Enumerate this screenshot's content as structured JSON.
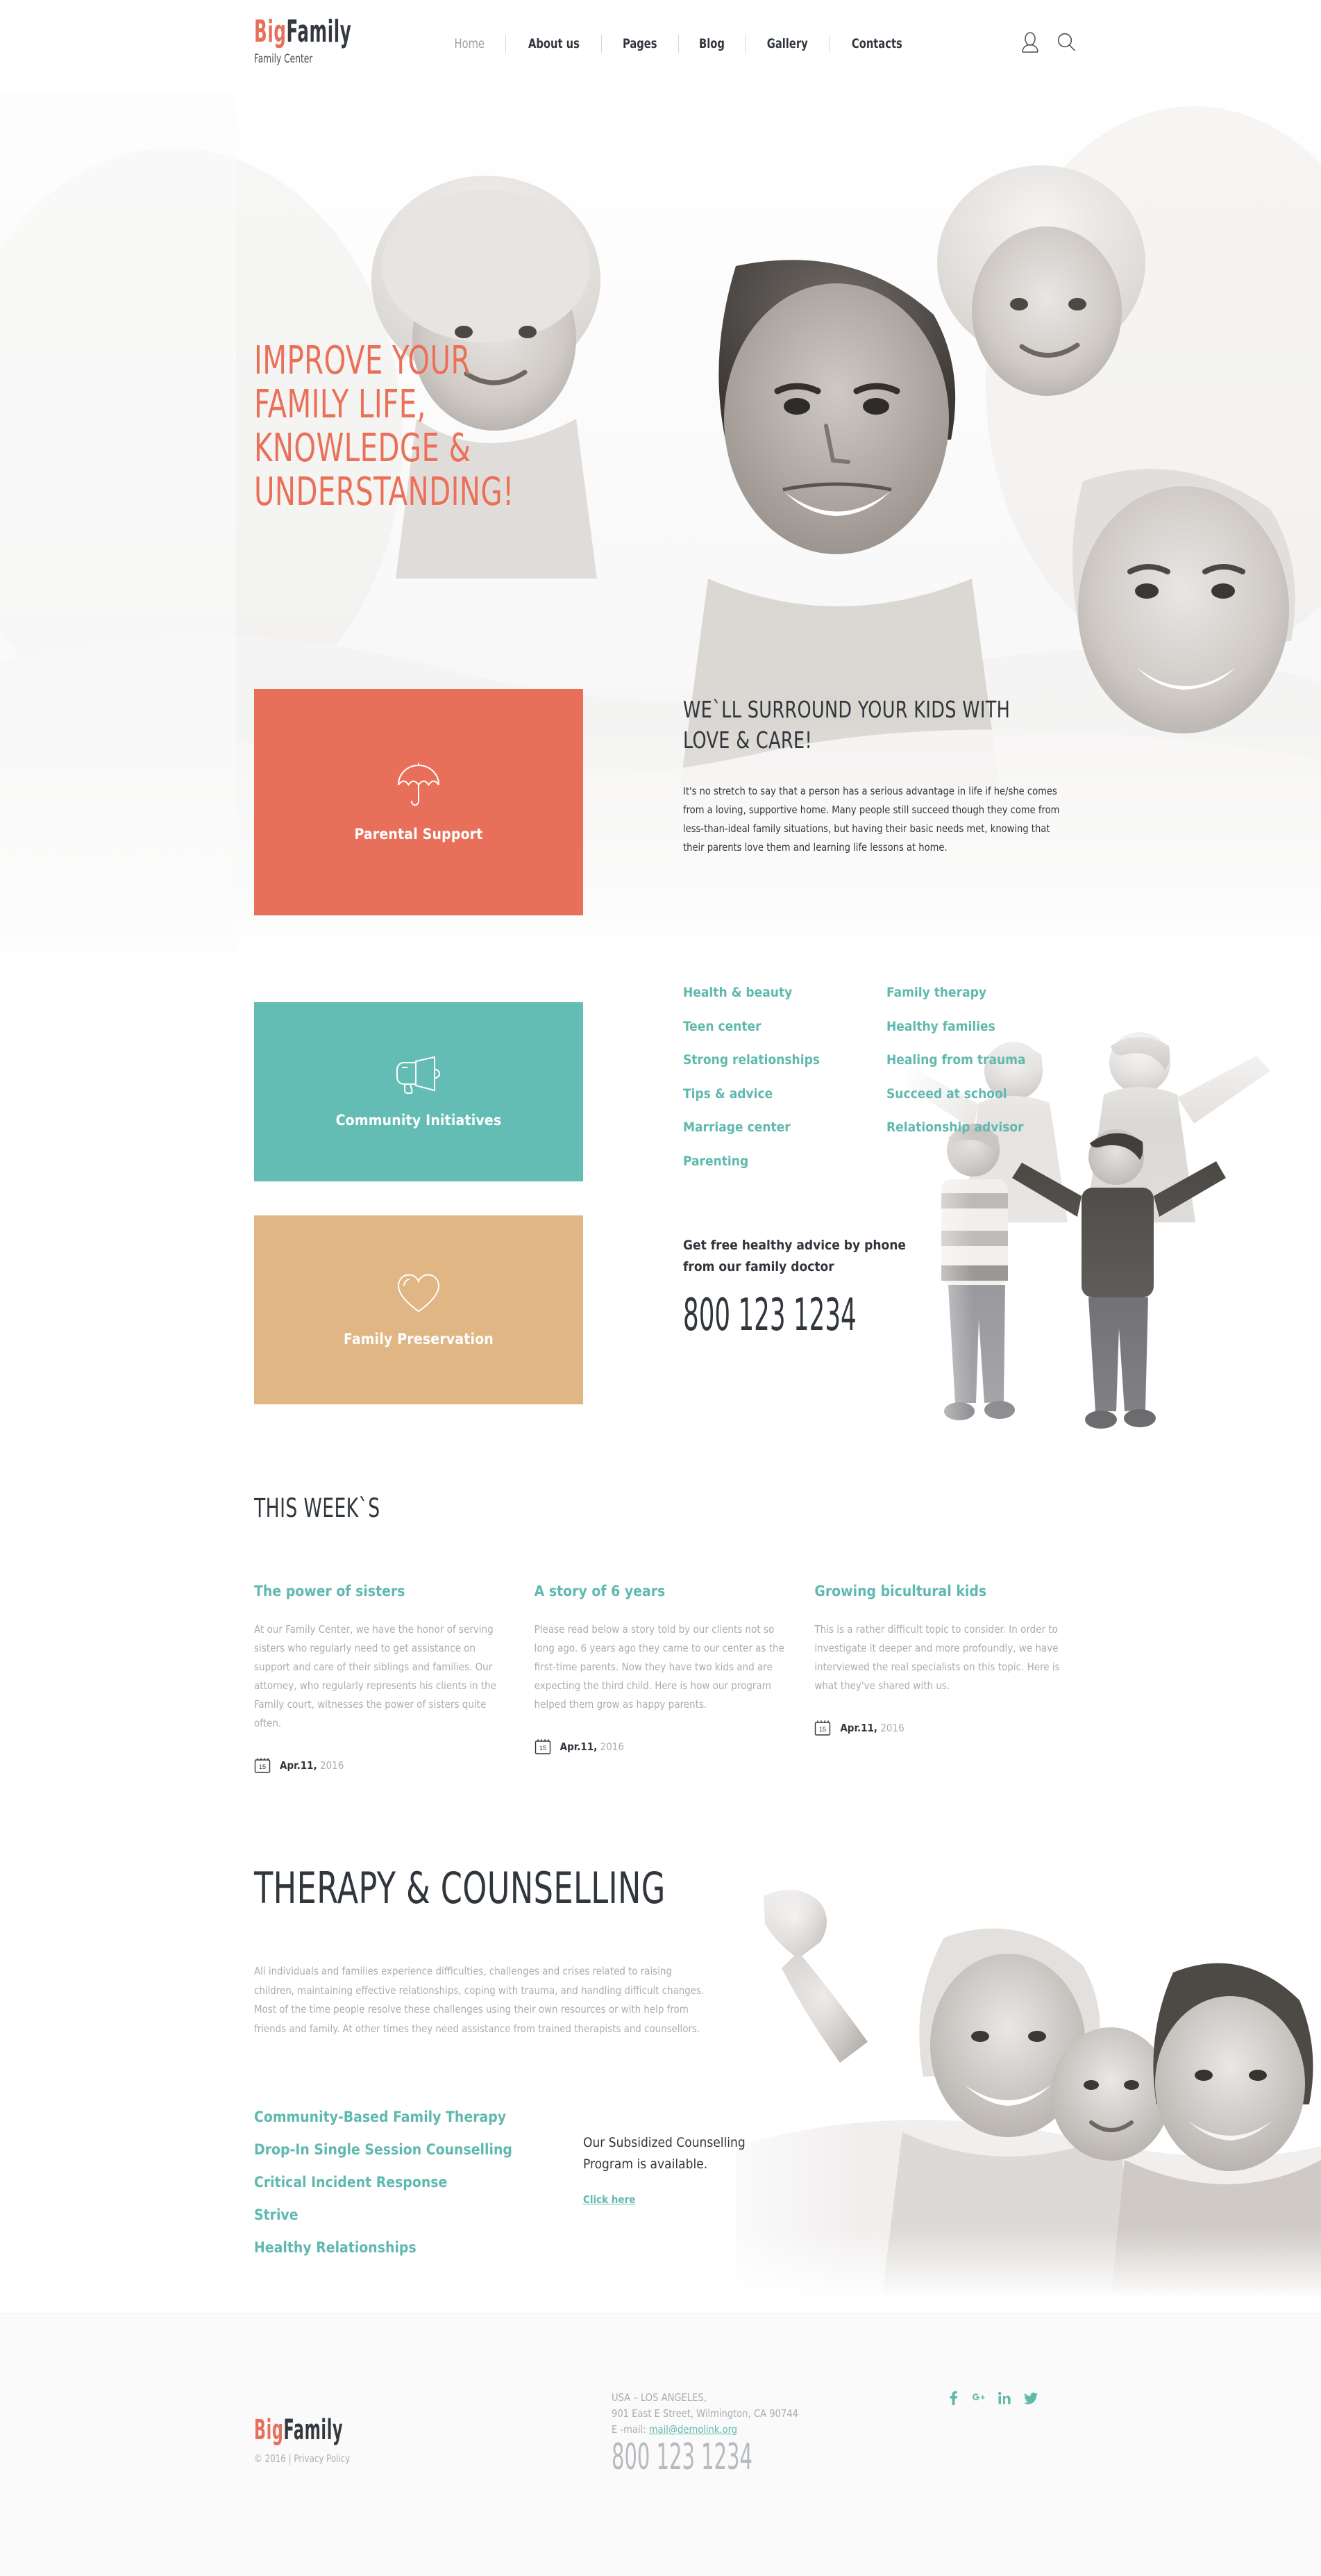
{
  "header": {
    "brand": {
      "part1": "Big",
      "part2": "Family",
      "tagline": "Family Center"
    },
    "nav": [
      {
        "label": "Home",
        "active": true
      },
      {
        "label": "About us",
        "active": false
      },
      {
        "label": "Pages",
        "active": false
      },
      {
        "label": "Blog",
        "active": false
      },
      {
        "label": "Gallery",
        "active": false
      },
      {
        "label": "Contacts",
        "active": false
      }
    ],
    "icons": [
      "user-icon",
      "search-icon"
    ]
  },
  "hero": {
    "title_line1": "Improve your",
    "title_line2": "family life,",
    "title_line3": "knowledge &",
    "title_line4": "understanding!",
    "heading": "We`ll surround your kids with love & care!",
    "paragraph": "It's no stretch to say that a person has a serious advantage in life if he/she comes from a loving, supportive home. Many people still succeed though they come from less-than-ideal family situations, but having their basic needs met, knowing that their parents love them and learning life lessons at home."
  },
  "cards": [
    {
      "label": "Parental Support",
      "icon": "umbrella-icon",
      "color": "#e8705a"
    },
    {
      "label": "Community Initiatives",
      "icon": "megaphone-icon",
      "color": "#64bdb4"
    },
    {
      "label": "Family Preservation",
      "icon": "heart-icon",
      "color": "#dfb684"
    }
  ],
  "service_links": {
    "column_left": [
      "Health & beauty",
      "Teen center",
      "Strong relationships",
      "Tips & advice",
      "Marriage center",
      "Parenting"
    ],
    "column_right": [
      "Family therapy",
      "Healthy families",
      "Healing from trauma",
      "Succeed at school",
      "Relationship advisor"
    ]
  },
  "phone_block": {
    "label": "Get free healthy advice by phone from our family doctor",
    "number": "800 123 1234"
  },
  "week": {
    "title": "This week`s",
    "posts": [
      {
        "title": "The power of sisters",
        "body": "At our Family Center, we have the honor of serving sisters who regularly need to get assistance on support and care of their siblings and families. Our attorney, who regularly represents his clients in the Family court, witnesses the power of sisters quite often.",
        "date_day": "15",
        "date_month": "Apr.11,",
        "date_year": "2016"
      },
      {
        "title": "A story of 6 years",
        "body": "Please read below a story told by our clients not so long ago. 6 years ago they came to our center as the first-time parents. Now they have two kids and are expecting the third child. Here is how our program helped them grow as happy parents.",
        "date_day": "15",
        "date_month": "Apr.11,",
        "date_year": "2016"
      },
      {
        "title": "Growing bicultural kids",
        "body": "This is a rather difficult topic to consider. In order to investigate it deeper and more profoundly, we have interviewed the real specialists on this topic. Here is what they've shared with us.",
        "date_day": "15",
        "date_month": "Apr.11,",
        "date_year": "2016"
      }
    ]
  },
  "therapy": {
    "title": "Therapy & Counselling",
    "paragraph": "All individuals and families experience difficulties, challenges and crises related to raising children, maintaining effective relationships, coping with trauma, and handling difficult changes. Most of the time people resolve these challenges using their own resources or with help from friends and family. At other times they need assistance from trained therapists and counsellors.",
    "links": [
      "Community-Based Family Therapy",
      "Drop-In Single Session Counselling",
      "Critical Incident Response",
      "Strive",
      "Healthy Relationships"
    ],
    "subsidy_text": "Our Subsidized Counselling Program is available.",
    "subsidy_link": "Click here"
  },
  "footer": {
    "brand": {
      "part1": "Big",
      "part2": "Family"
    },
    "copyright": "© 2016 | Privacy Policy",
    "address_line1": "USA – LOS ANGELES,",
    "address_line2": "901 East E Street, Wilmington, CA 90744",
    "email_label": "E -mail:",
    "email": "mail@demolink.org",
    "phone": "800 123 1234",
    "social": [
      "f",
      "g+",
      "in",
      "t"
    ]
  },
  "colors": {
    "accent_orange": "#e8705a",
    "accent_teal": "#64bdb4",
    "accent_tan": "#dfb684",
    "link_teal": "#5fb9ae",
    "text_dark": "#31363c",
    "text_muted": "#a9adb1",
    "footer_bg": "#fafafa"
  }
}
